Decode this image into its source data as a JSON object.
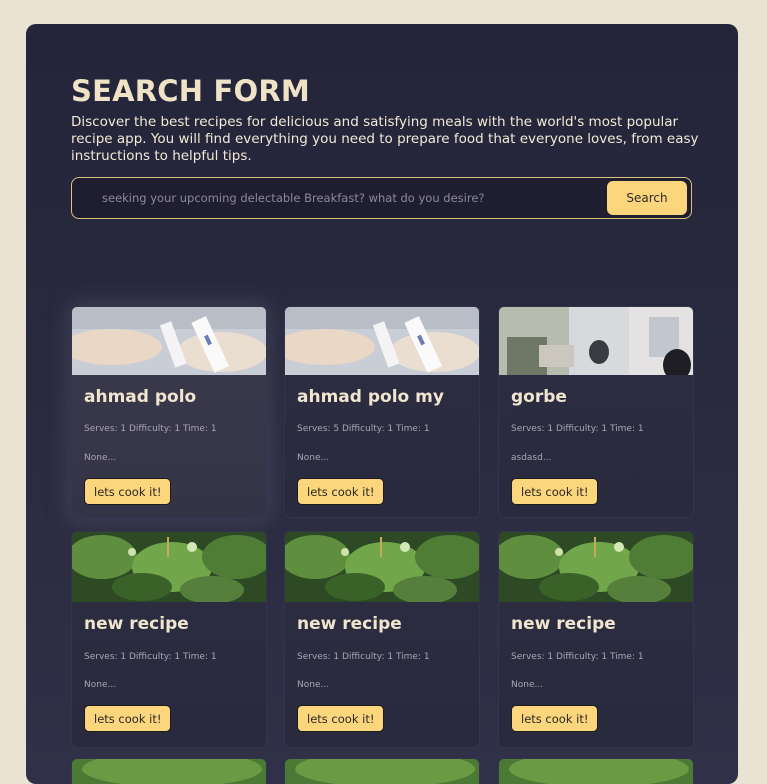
{
  "header": {
    "title": "SEARCH FORM",
    "description": "Discover the best recipes for delicious and satisfying meals with the world's most popular recipe app. You will find everything you need to prepare food that everyone loves, from easy instructions to helpful tips."
  },
  "search": {
    "placeholder": "seeking your upcoming delectable Breakfast? what do you desire?",
    "button_label": "Search"
  },
  "recipes": [
    {
      "title": "ahmad polo",
      "meta": "Serves: 1 Difficulty: 1 Time: 1",
      "desc": "None...",
      "button": "lets cook it!",
      "image": "lab-test-photo"
    },
    {
      "title": "ahmad polo my",
      "meta": "Serves: 5 Difficulty: 1 Time: 1",
      "desc": "None...",
      "button": "lets cook it!",
      "image": "lab-test-photo"
    },
    {
      "title": "gorbe",
      "meta": "Serves: 1 Difficulty: 1 Time: 1",
      "desc": "asdasd...",
      "button": "lets cook it!",
      "image": "office-booth-photo"
    },
    {
      "title": "new recipe",
      "meta": "Serves: 1 Difficulty: 1 Time: 1",
      "desc": "None...",
      "button": "lets cook it!",
      "image": "herbs-photo"
    },
    {
      "title": "new recipe",
      "meta": "Serves: 1 Difficulty: 1 Time: 1",
      "desc": "None...",
      "button": "lets cook it!",
      "image": "herbs-photo"
    },
    {
      "title": "new recipe",
      "meta": "Serves: 1 Difficulty: 1 Time: 1",
      "desc": "None...",
      "button": "lets cook it!",
      "image": "herbs-photo"
    }
  ],
  "colors": {
    "page_bg": "#ebe3d1",
    "panel_bg": "#292a3e",
    "accent": "#fcd67c",
    "title_text": "#f0e3c5"
  }
}
